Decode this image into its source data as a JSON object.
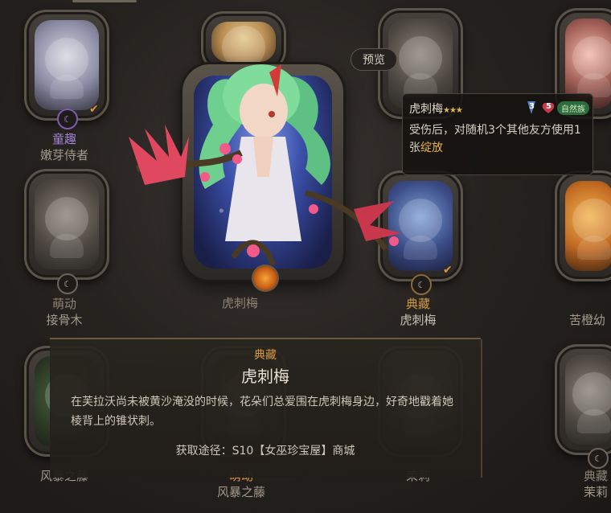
{
  "preview_label": "预览",
  "featured": {
    "name": "虎刺梅",
    "rarity": "典藏"
  },
  "grid_cards": [
    {
      "rarity": "童趣",
      "name": "嫩芽侍者",
      "rarity_color": "#a583d6"
    },
    {
      "rarity": "萌动",
      "name": "接骨木",
      "rarity_color": "#8e8577"
    },
    {
      "rarity": "典藏",
      "name": "虎刺梅",
      "rarity_color": "#d49a3c"
    },
    {
      "rarity": "",
      "name": "苦橙幼",
      "rarity_color": "#8e8577"
    },
    {
      "rarity": "",
      "name": "风暴之藤",
      "rarity_color": "#8e8577"
    },
    {
      "rarity": "萌动",
      "name": "风暴之藤",
      "rarity_color": "#d49a3c"
    },
    {
      "rarity": "",
      "name": "茉莉",
      "rarity_color": "#8e8577"
    },
    {
      "rarity": "典藏",
      "name": "茉莉",
      "rarity_color": "#8e8577"
    }
  ],
  "tooltip": {
    "name": "虎刺梅",
    "stars": "★★★",
    "attack": "3",
    "health": "5",
    "tribe": "自然族",
    "desc_before": "受伤后，对随机3个其他友方使用1张",
    "desc_highlight": "绽放"
  },
  "detail": {
    "rarity": "典藏",
    "name": "虎刺梅",
    "description": "在芙拉沃尚未被黄沙淹没的时候，花朵们总爱围在虎刺梅身边，好奇地戳着她棱背上的锥状刺。",
    "source_label": "获取途径：S10【女巫珍宝屋】商城"
  }
}
